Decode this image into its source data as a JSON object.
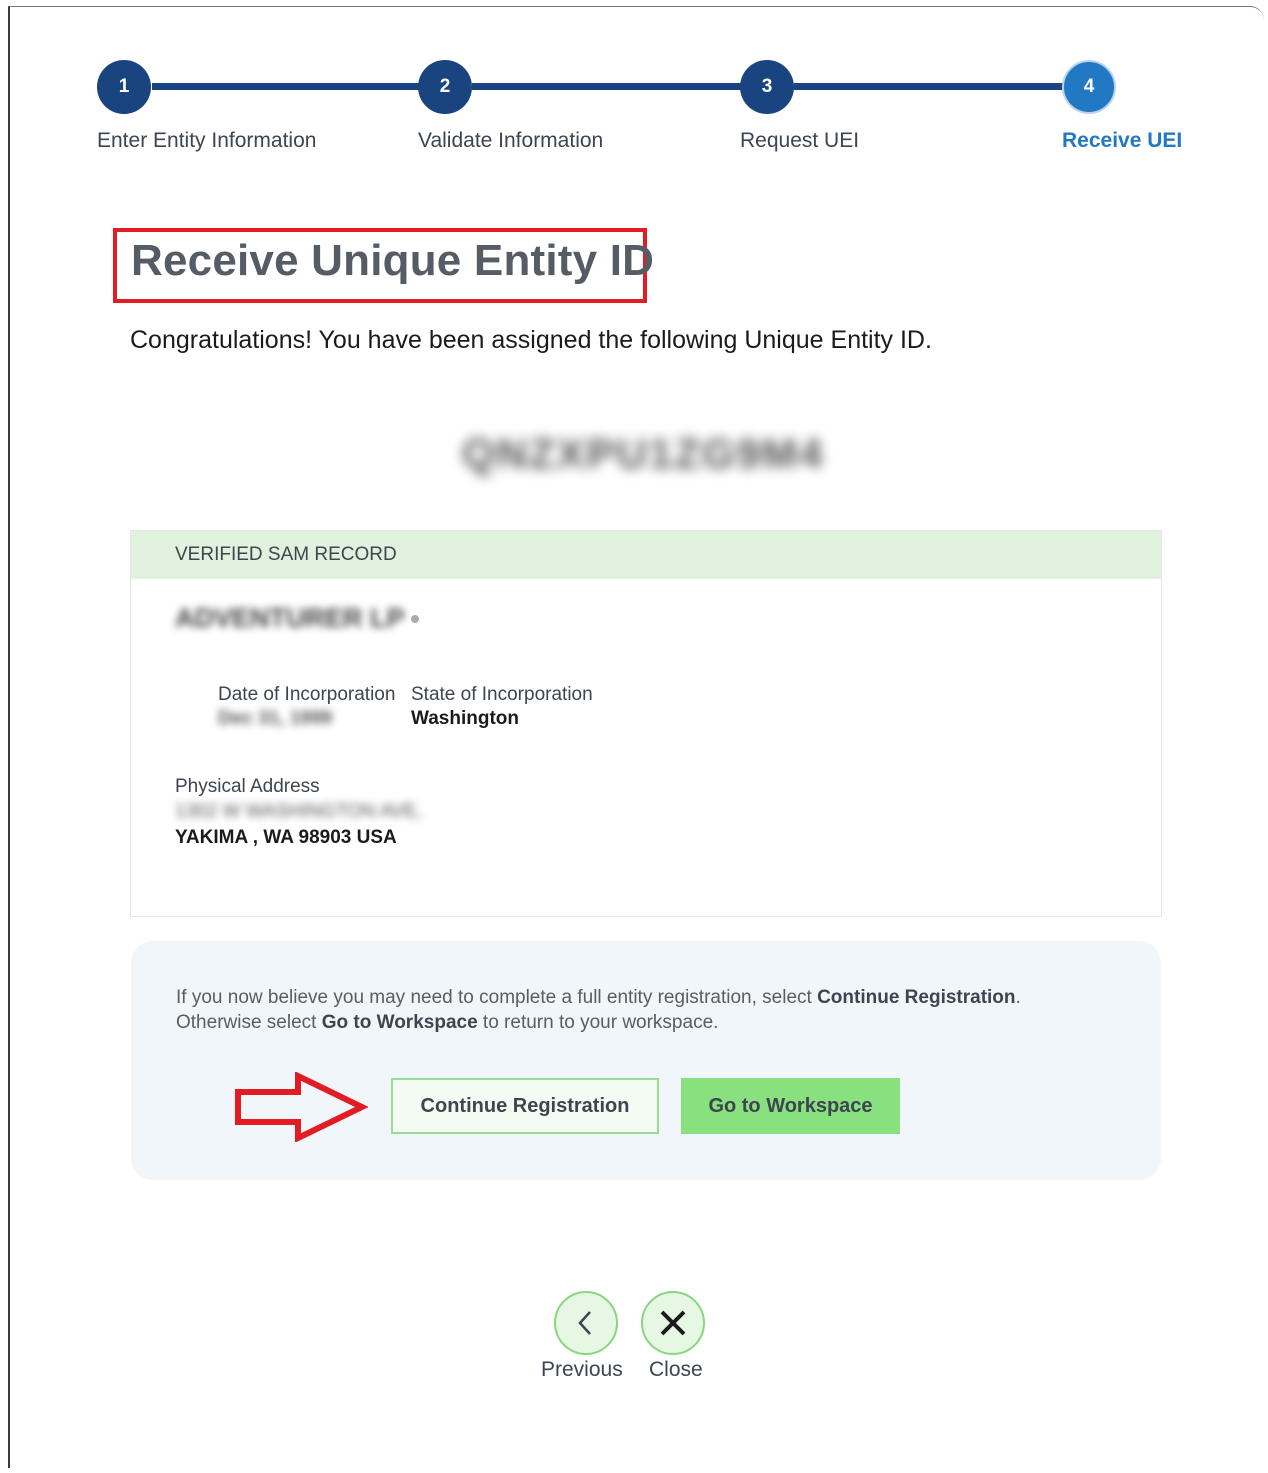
{
  "stepper": {
    "steps": [
      {
        "number": "1",
        "label": "Enter Entity Information"
      },
      {
        "number": "2",
        "label": "Validate Information"
      },
      {
        "number": "3",
        "label": "Request UEI"
      },
      {
        "number": "4",
        "label": "Receive UEI"
      }
    ],
    "current_step": 4
  },
  "page": {
    "title": "Receive Unique Entity ID",
    "congrats": "Congratulations! You have been assigned the following Unique Entity ID.",
    "uei_value": "QNZXPU1ZG9M4"
  },
  "record": {
    "header": "VERIFIED SAM RECORD",
    "entity_name": "ADVENTURER LP",
    "date_of_incorporation_label": "Date of Incorporation",
    "date_of_incorporation_value": "Dec 31, 1999",
    "state_of_incorporation_label": "State of Incorporation",
    "state_of_incorporation_value": "Washington",
    "physical_address_label": "Physical Address",
    "address_line1": "1302 W WASHINGTON AVE,",
    "address_line2": "YAKIMA , WA 98903 USA"
  },
  "info": {
    "line1_prefix": "If you now believe you may need to complete a full entity registration, select ",
    "line1_bold": "Continue Registration",
    "line1_suffix": ".",
    "line2_prefix": "Otherwise select ",
    "line2_bold": "Go to Workspace",
    "line2_suffix": " to return to your workspace.",
    "continue_button": "Continue Registration",
    "workspace_button": "Go to Workspace"
  },
  "nav": {
    "previous_label": "Previous",
    "close_label": "Close"
  },
  "colors": {
    "stepper_done": "#1a4480",
    "stepper_current": "#2378c3",
    "highlight_red": "#e31c23",
    "record_header_bg": "#e0f2dd",
    "button_green": "#88e07f"
  }
}
